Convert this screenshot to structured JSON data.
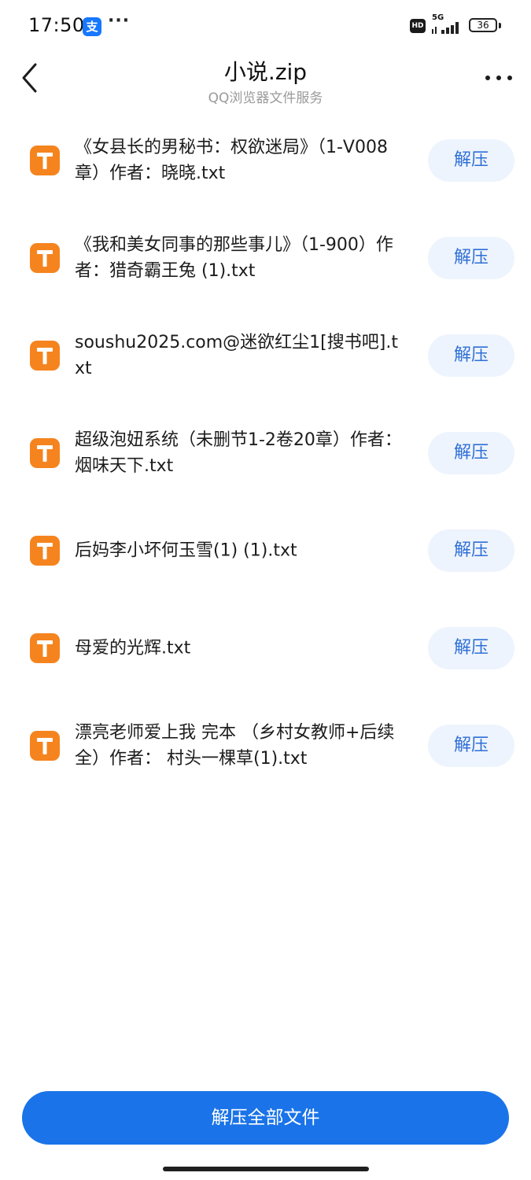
{
  "status_bar": {
    "time": "17:50",
    "notification_app_glyph": "支",
    "more_glyph": "···",
    "hd_label": "HD",
    "network_label": "5G",
    "battery_level": "36"
  },
  "header": {
    "title": "小说.zip",
    "subtitle": "QQ浏览器文件服务"
  },
  "files": [
    {
      "name": "《女县长的男秘书：权欲迷局》（1-V008章）作者：晓晓.txt",
      "action_label": "解压"
    },
    {
      "name": "《我和美女同事的那些事儿》（1-900）作者：猎奇霸王兔 (1).txt",
      "action_label": "解压"
    },
    {
      "name": "soushu2025.com@迷欲红尘1[搜书吧].txt",
      "action_label": "解压"
    },
    {
      "name": "超级泡妞系统（未删节1-2卷20章）作者：烟味天下.txt",
      "action_label": "解压"
    },
    {
      "name": "后妈李小坏何玉雪(1) (1).txt",
      "action_label": "解压"
    },
    {
      "name": "母爱的光辉.txt",
      "action_label": "解压"
    },
    {
      "name": "漂亮老师爱上我 完本 （乡村女教师+后续全）作者： 村头一棵草(1).txt",
      "action_label": "解压"
    }
  ],
  "footer": {
    "extract_all_label": "解压全部文件"
  },
  "colors": {
    "accent": "#1a73e8",
    "button_bg": "#eef4fd",
    "button_text": "#2f6fd6",
    "file_icon": "#f5841f"
  },
  "icons": {
    "back": "back-arrow-icon",
    "more": "more-dots-icon",
    "file": "txt-file-icon"
  }
}
